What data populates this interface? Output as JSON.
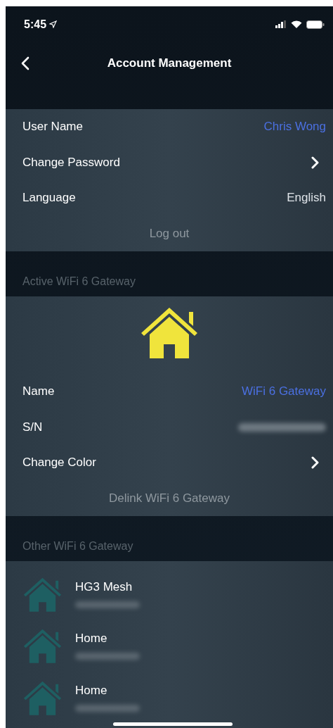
{
  "status_bar": {
    "time": "5:45"
  },
  "header": {
    "title": "Account Management"
  },
  "account": {
    "rows": [
      {
        "kind": "value",
        "label": "User Name",
        "value": "Chris Wong",
        "highlight": true
      },
      {
        "kind": "link",
        "label": "Change Password"
      },
      {
        "kind": "value",
        "label": "Language",
        "value": "English",
        "highlight": false
      }
    ],
    "action": "Log out"
  },
  "active_gateway": {
    "heading": "Active WiFi 6 Gateway",
    "rows": [
      {
        "kind": "value",
        "label": "Name",
        "value": "WiFi 6 Gateway",
        "highlight": true
      },
      {
        "kind": "hidden",
        "label": "S/N"
      },
      {
        "kind": "link",
        "label": "Change Color"
      }
    ],
    "action": "Delink WiFi 6 Gateway"
  },
  "other_gateways": {
    "heading": "Other WiFi 6 Gateway",
    "items": [
      {
        "name": "HG3 Mesh"
      },
      {
        "name": "Home"
      },
      {
        "name": "Home"
      }
    ]
  }
}
